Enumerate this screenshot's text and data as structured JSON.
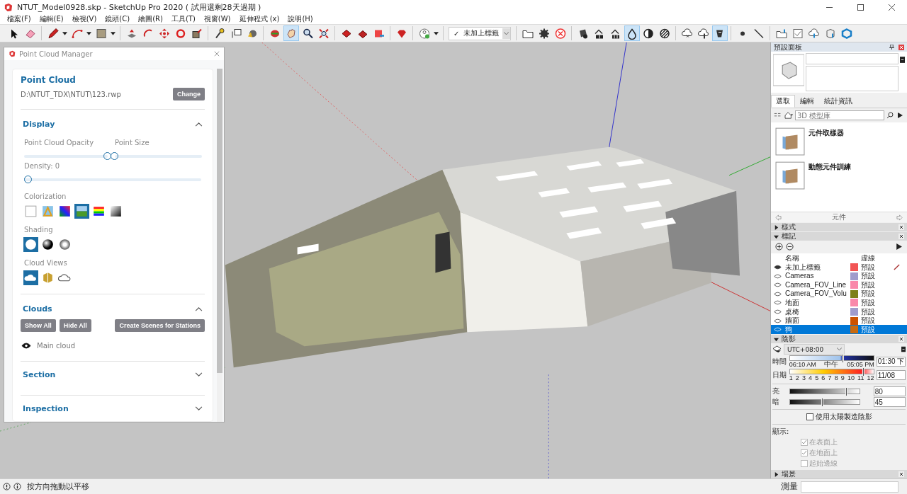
{
  "window": {
    "title": "NTUT_Model0928.skp - SketchUp Pro 2020 ( 試用還剩28天過期 )"
  },
  "menu": [
    "檔案(F)",
    "編輯(E)",
    "檢視(V)",
    "鏡頭(C)",
    "繪圖(R)",
    "工具(T)",
    "視窗(W)",
    "延伸程式 (x)",
    "說明(H)"
  ],
  "toolbar": {
    "tag_dropdown": "未加上標籤",
    "tag_check": "✓"
  },
  "point_cloud_manager": {
    "title": "Point Cloud Manager",
    "heading": "Point Cloud",
    "path": "D:\\NTUT_TDX\\NTUT\\123.rwp",
    "change_button": "Change",
    "display": {
      "title": "Display",
      "expanded": true,
      "sliders": [
        {
          "label": "Point Cloud Opacity",
          "level": 1
        },
        {
          "label": "Point Size",
          "level": 0
        }
      ],
      "density": {
        "label": "Density: 0",
        "level": 0
      },
      "colorization": {
        "label": "Colorization",
        "options": [
          {
            "kind": "blank",
            "selected": false
          },
          {
            "kind": "image",
            "selected": false
          },
          {
            "kind": "rgb",
            "selected": false
          },
          {
            "kind": "elevation",
            "selected": true
          },
          {
            "kind": "rainbow",
            "selected": false
          },
          {
            "kind": "gray",
            "selected": false
          }
        ]
      },
      "shading": {
        "label": "Shading",
        "options": [
          {
            "kind": "flat",
            "selected": true
          },
          {
            "kind": "dark",
            "selected": false
          },
          {
            "kind": "light",
            "selected": false
          }
        ]
      },
      "cloud_views": {
        "label": "Cloud Views",
        "options": [
          {
            "kind": "cloud",
            "selected": true
          },
          {
            "kind": "box",
            "selected": false
          },
          {
            "kind": "outline",
            "selected": false
          }
        ]
      }
    },
    "clouds": {
      "title": "Clouds",
      "expanded": true,
      "buttons": [
        "Show All",
        "Hide All"
      ],
      "scene_button": "Create Scenes for Stations",
      "items": [
        {
          "name": "Main cloud",
          "visible": true
        }
      ]
    },
    "sections": [
      {
        "title": "Section",
        "expanded": false
      },
      {
        "title": "Inspection",
        "expanded": false
      }
    ]
  },
  "tray": {
    "title": "預設面板",
    "tabs": [
      {
        "label": "選取",
        "selected": true
      },
      {
        "label": "編輯",
        "selected": false
      },
      {
        "label": "統計資訊",
        "selected": false
      }
    ],
    "search_placeholder": "3D 模型庫",
    "components": [
      {
        "name": "元件取樣器"
      },
      {
        "name": "動態元件訓練"
      }
    ],
    "components_footer": "元件",
    "styles": {
      "title": "樣式",
      "expanded": false
    },
    "tags": {
      "title": "標記",
      "expanded": true,
      "columns": [
        "名稱",
        "虛線"
      ],
      "rows": [
        {
          "name": "未加上標籤",
          "color": "#f25454",
          "dash": "預設",
          "current": true,
          "selected": false
        },
        {
          "name": "Cameras",
          "color": "#a09ccc",
          "dash": "預設",
          "current": false,
          "selected": false
        },
        {
          "name": "Camera_FOV_Line",
          "color": "#f988aa",
          "dash": "預設",
          "current": false,
          "selected": false
        },
        {
          "name": "Camera_FOV_Volu",
          "color": "#7e8018",
          "dash": "預設",
          "current": false,
          "selected": false
        },
        {
          "name": "地面",
          "color": "#f988aa",
          "dash": "預設",
          "current": false,
          "selected": false
        },
        {
          "name": "桌椅",
          "color": "#a09ccc",
          "dash": "預設",
          "current": false,
          "selected": false
        },
        {
          "name": "牆面",
          "color": "#cc5200",
          "dash": "預設",
          "current": false,
          "selected": false
        },
        {
          "name": "狗",
          "color": "#c86a10",
          "dash": "預設",
          "current": false,
          "selected": true
        }
      ]
    },
    "shadows": {
      "title": "陰影",
      "expanded": true,
      "timezone": "UTC+08:00",
      "time": {
        "label": "時間",
        "ticks": [
          "06:10 AM",
          "中午",
          "05:05 PM"
        ],
        "level": 0.62,
        "value": "01:30 下"
      },
      "date": {
        "label": "日期",
        "ticks": [
          "1",
          "2",
          "3",
          "4",
          "5",
          "6",
          "7",
          "8",
          "9",
          "10",
          "11",
          "12"
        ],
        "level": 0.87,
        "value": "11/08"
      },
      "light": {
        "label": "亮",
        "level": 0.8,
        "value": "80"
      },
      "dark": {
        "label": "暗",
        "level": 0.45,
        "value": "45"
      },
      "use_sun": {
        "label": "使用太陽製造陰影",
        "checked": false
      },
      "display_label": "顯示:",
      "display_options": [
        {
          "label": "在表面上",
          "checked": true
        },
        {
          "label": "在地面上",
          "checked": true
        },
        {
          "label": "起始邊線",
          "checked": false
        }
      ]
    },
    "scenes": {
      "title": "場景",
      "expanded": false
    },
    "measure_label": "測量"
  },
  "status_bar": {
    "message": "按方向拖動以平移"
  }
}
